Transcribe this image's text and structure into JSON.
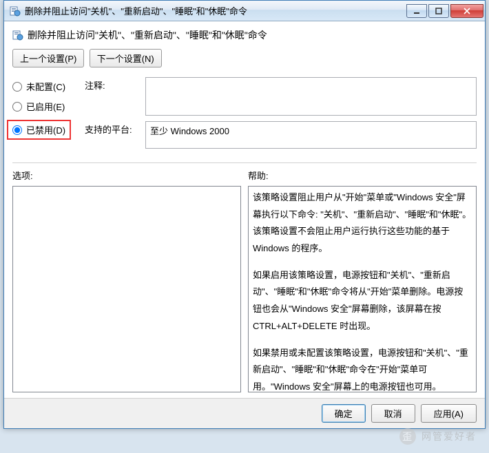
{
  "titlebar": {
    "text": "删除并阻止访问\"关机\"、\"重新启动\"、\"睡眠\"和\"休眠\"命令"
  },
  "header": {
    "text": "删除并阻止访问\"关机\"、\"重新启动\"、\"睡眠\"和\"休眠\"命令"
  },
  "nav": {
    "prev": "上一个设置(P)",
    "next": "下一个设置(N)"
  },
  "radios": {
    "notconfigured": "未配置(C)",
    "enabled": "已启用(E)",
    "disabled": "已禁用(D)",
    "selected": "disabled"
  },
  "fields": {
    "comment_label": "注释:",
    "comment_value": "",
    "platform_label": "支持的平台:",
    "platform_value": "至少 Windows 2000"
  },
  "cols": {
    "options_label": "选项:",
    "help_label": "帮助:"
  },
  "help": {
    "p1": "该策略设置阻止用户从\"开始\"菜单或\"Windows 安全\"屏幕执行以下命令: \"关机\"、\"重新启动\"、\"睡眠\"和\"休眠\"。该策略设置不会阻止用户运行执行这些功能的基于 Windows 的程序。",
    "p2": "如果启用该策略设置，电源按钮和\"关机\"、\"重新启动\"、\"睡眠\"和\"休眠\"命令将从\"开始\"菜单删除。电源按钮也会从\"Windows 安全\"屏幕删除，该屏幕在按 CTRL+ALT+DELETE 时出现。",
    "p3": "如果禁用或未配置该策略设置，电源按钮和\"关机\"、\"重新启动\"、\"睡眠\"和\"休眠\"命令在\"开始\"菜单可用。\"Windows 安全\"屏幕上的电源按钮也可用。"
  },
  "footer": {
    "ok": "确定",
    "cancel": "取消",
    "apply": "应用(A)"
  },
  "watermark": {
    "text": "网管爱好者"
  }
}
